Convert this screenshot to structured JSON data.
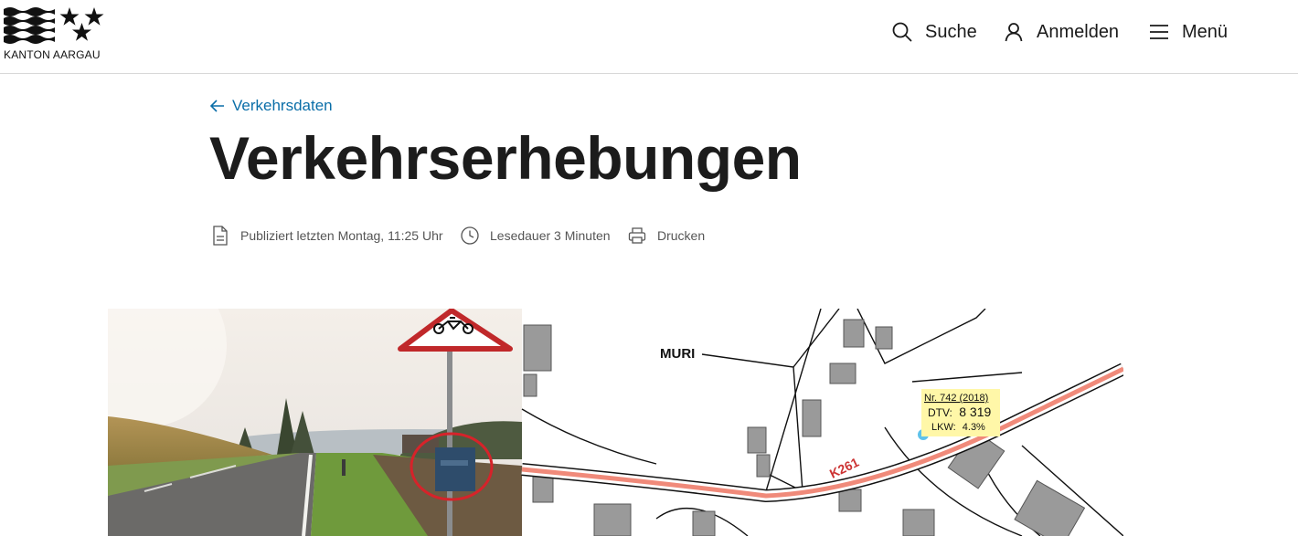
{
  "header": {
    "logo_text": "KANTON AARGAU",
    "nav": {
      "search_label": "Suche",
      "login_label": "Anmelden",
      "menu_label": "Menü"
    }
  },
  "page": {
    "back_label": "Verkehrsdaten",
    "title": "Verkehrserhebungen",
    "meta": {
      "published": "Publiziert letzten Montag, 11:25 Uhr",
      "read_time": "Lesedauer 3 Minuten",
      "print": "Drucken"
    }
  },
  "hero": {
    "map_place": "MURI",
    "road_label": "K261",
    "station_label": "Nr. 742 (2018)",
    "dtv_label": "DTV:",
    "dtv_value": "8 319",
    "lkw_label": "LKW:",
    "lkw_value": "4.3%"
  },
  "colors": {
    "link": "#0a6ea8",
    "road_highlight": "#f08a7a",
    "callout_bg": "#fff7a8"
  }
}
